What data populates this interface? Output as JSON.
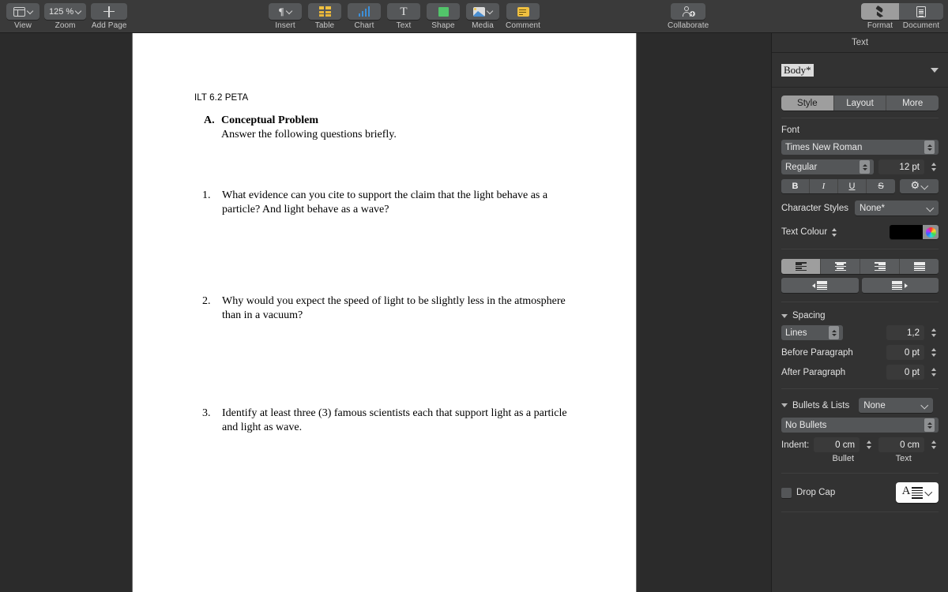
{
  "toolbar": {
    "left": [
      {
        "name": "view",
        "label": "View",
        "icon": "sidebar-panel-icon",
        "has_chevron": true
      },
      {
        "name": "zoom",
        "label": "Zoom",
        "value": "125 %",
        "icon": "zoom-value",
        "has_chevron": true
      },
      {
        "name": "add-page",
        "label": "Add Page",
        "icon": "plus-icon",
        "has_chevron": false
      }
    ],
    "center": [
      {
        "name": "insert",
        "label": "Insert",
        "icon": "pilcrow-icon",
        "has_chevron": true
      },
      {
        "name": "table",
        "label": "Table",
        "icon": "table-grid-icon",
        "has_chevron": false
      },
      {
        "name": "chart",
        "label": "Chart",
        "icon": "bar-chart-icon",
        "has_chevron": false
      },
      {
        "name": "text",
        "label": "Text",
        "icon": "text-t-icon",
        "has_chevron": false
      },
      {
        "name": "shape",
        "label": "Shape",
        "icon": "square-shape-icon",
        "has_chevron": false
      },
      {
        "name": "media",
        "label": "Media",
        "icon": "photo-icon",
        "has_chevron": true
      },
      {
        "name": "comment",
        "label": "Comment",
        "icon": "comment-note-icon",
        "has_chevron": false
      }
    ],
    "collaborate": {
      "label": "Collaborate",
      "icon": "person-add-icon"
    },
    "right": [
      {
        "name": "format",
        "label": "Format",
        "icon": "paintbrush-icon",
        "active": true
      },
      {
        "name": "document",
        "label": "Document",
        "icon": "document-lines-icon",
        "active": false
      }
    ]
  },
  "document": {
    "header": "ILT 6.2 PETA",
    "section": {
      "marker": "A.",
      "title": "Conceptual Problem",
      "subtitle": "Answer the following questions briefly."
    },
    "questions": [
      {
        "num": "1.",
        "text": "What evidence can you cite to support the claim that the light behave as a particle? And light behave as a wave?"
      },
      {
        "num": "2.",
        "text": "Why would you expect the speed of light to be slightly less in the atmosphere than in a vacuum?"
      },
      {
        "num": "3.",
        "text": "Identify at least three (3) famous scientists each that support light as a particle and light as wave."
      }
    ]
  },
  "panel": {
    "title": "Text",
    "paragraph_style": "Body*",
    "tabs": [
      {
        "label": "Style",
        "active": true
      },
      {
        "label": "Layout",
        "active": false
      },
      {
        "label": "More",
        "active": false
      }
    ],
    "font": {
      "section_label": "Font",
      "family": "Times New Roman",
      "weight": "Regular",
      "size": "12 pt",
      "bold_label": "B",
      "italic_label": "I",
      "underline_label": "U",
      "strikethrough_label": "S",
      "gear_label": "",
      "character_styles_label": "Character Styles",
      "character_styles_value": "None*"
    },
    "text_colour": {
      "label": "Text Colour",
      "swatch_hex": "#000000"
    },
    "alignment": {
      "options": [
        "align-left",
        "align-centre",
        "align-right",
        "align-justify"
      ],
      "active_index": 0,
      "indent_decrease": "decrease-indent",
      "indent_increase": "increase-indent"
    },
    "spacing": {
      "section_label": "Spacing",
      "mode": "Lines",
      "value": "1,2",
      "before_label": "Before Paragraph",
      "before_value": "0 pt",
      "after_label": "After Paragraph",
      "after_value": "0 pt"
    },
    "bullets": {
      "section_label": "Bullets & Lists",
      "preset": "None",
      "type": "No Bullets",
      "indent_label": "Indent:",
      "bullet_indent": "0 cm",
      "text_indent": "0 cm",
      "bullet_caption": "Bullet",
      "text_caption": "Text"
    },
    "drop_cap": {
      "label": "Drop Cap",
      "checked": false,
      "preview_glyph": "A"
    }
  }
}
